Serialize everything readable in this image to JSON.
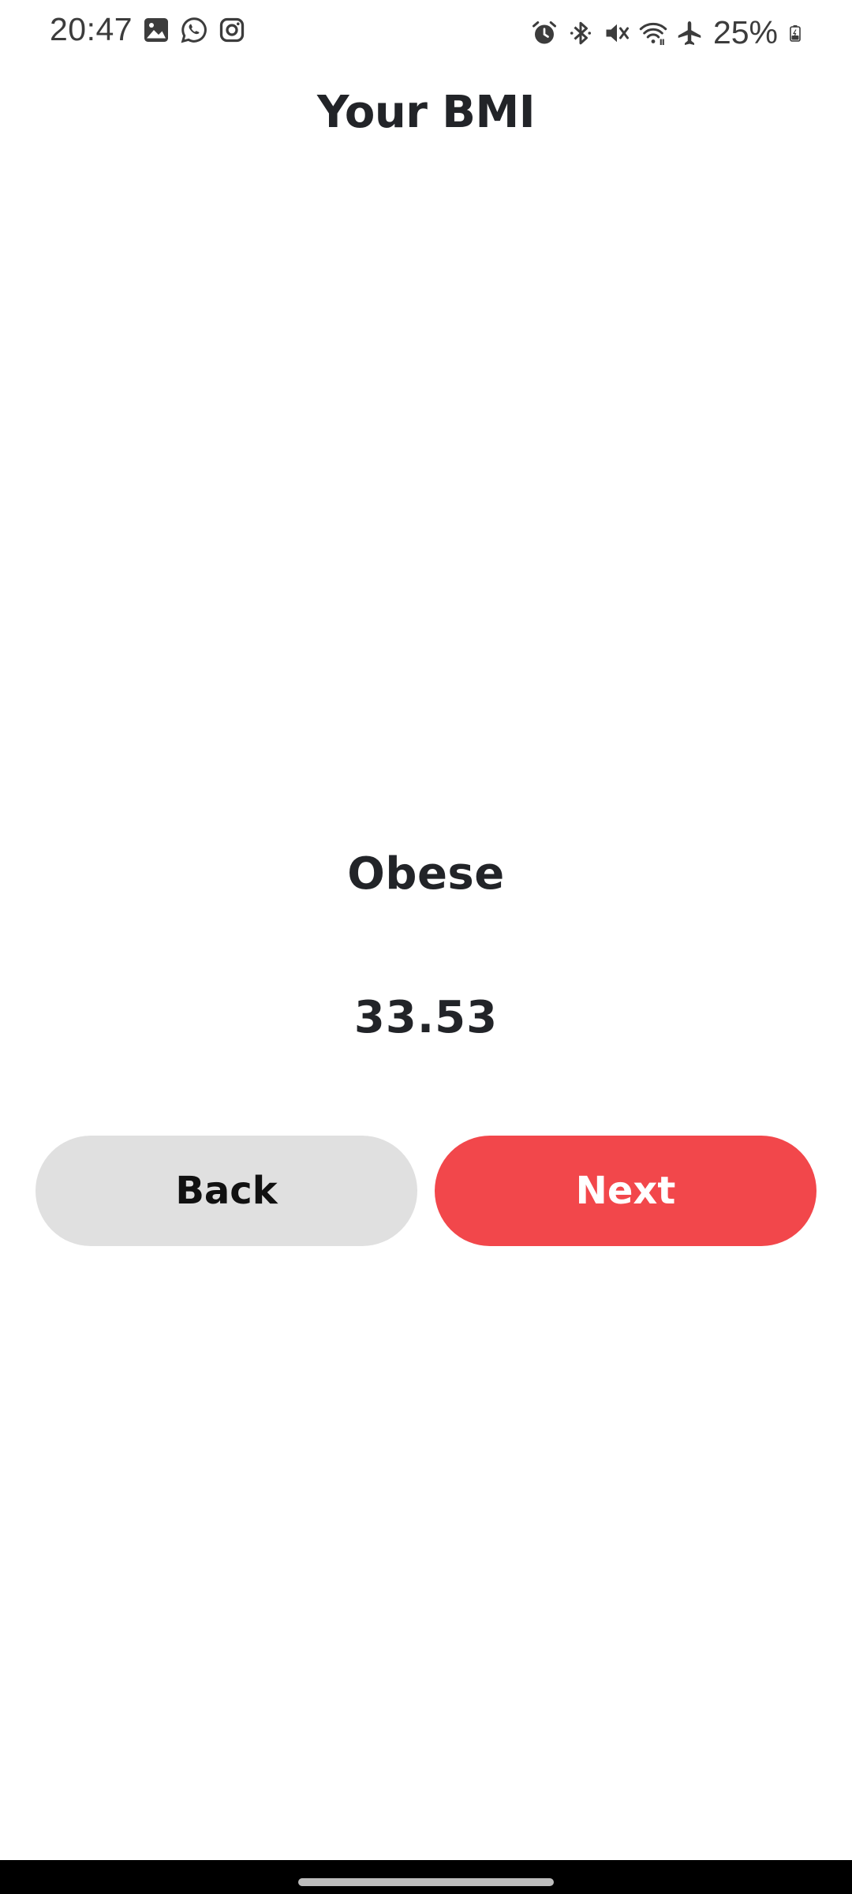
{
  "status_bar": {
    "time": "20:47",
    "left_icons": [
      "gallery-icon",
      "whatsapp-icon",
      "instagram-icon"
    ],
    "right_icons": [
      "alarm-icon",
      "bluetooth-icon",
      "mute-icon",
      "wifi-icon",
      "airplane-icon",
      "battery-icon"
    ],
    "battery_percent": "25%"
  },
  "header": {
    "title": "Your BMI"
  },
  "result": {
    "category": "Obese",
    "value": "33.53"
  },
  "actions": {
    "back_label": "Back",
    "next_label": "Next"
  },
  "colors": {
    "accent": "#f2474b",
    "secondary_button": "#e0e0e0",
    "text": "#222428"
  }
}
